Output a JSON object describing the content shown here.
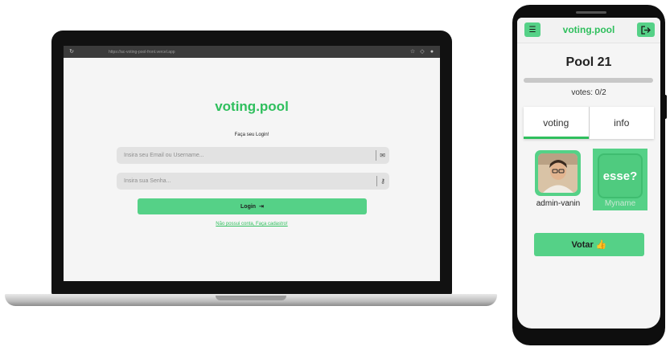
{
  "laptop": {
    "browser": {
      "url": "https://ac-voting-pool-front.vercel.app"
    },
    "login": {
      "logo": "voting.pool",
      "subtitle": "Faça seu Login!",
      "email_placeholder": "Insira seu Email ou Username...",
      "password_placeholder": "Insira sua Senha...",
      "login_button": "Login",
      "signup_link": "Não possui conta, Faça cadastro!"
    }
  },
  "phone": {
    "header": {
      "logo": "voting.pool"
    },
    "pool": {
      "title": "Pool 21",
      "votes_text": "votes: 0/2",
      "vote_progress_fraction": 0.0
    },
    "tabs": [
      {
        "label": "voting",
        "active": true
      },
      {
        "label": "info",
        "active": false
      }
    ],
    "candidates": [
      {
        "name": "admin-vanin"
      },
      {
        "name": "Myname",
        "placeholder_text": "esse?"
      }
    ],
    "vote_button": {
      "label": "Votar",
      "emoji": "👍"
    }
  },
  "colors": {
    "brand_green": "#2fbf5d",
    "button_green": "#55d187",
    "screen_background": "#f5f5f5"
  }
}
